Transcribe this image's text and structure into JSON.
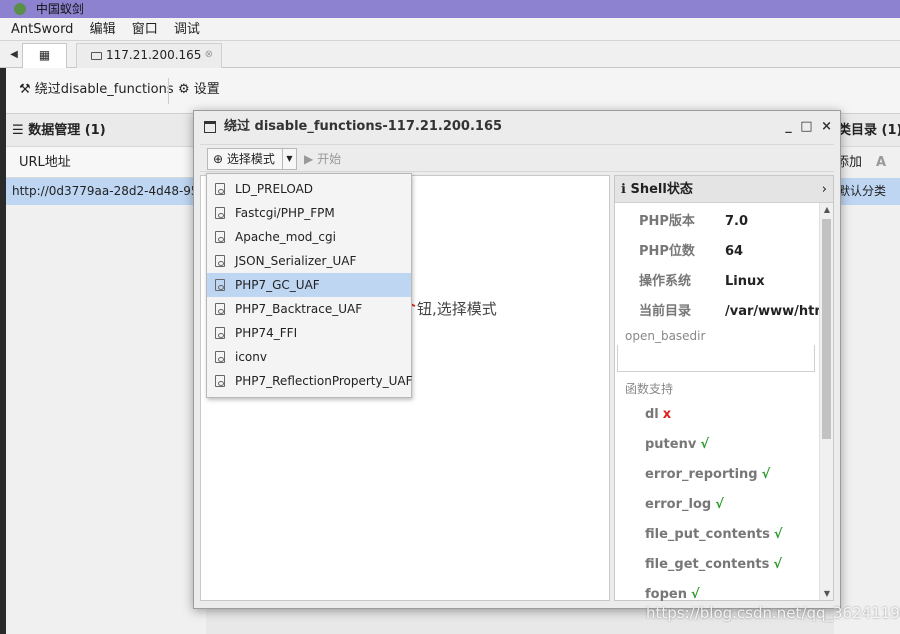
{
  "titlebar": {
    "title": "中国蚁剑"
  },
  "menu": [
    "AntSword",
    "编辑",
    "窗口",
    "调试"
  ],
  "tabs": {
    "home_icon": "grid-icon",
    "host": "117.21.200.165"
  },
  "toolbar": {
    "bypass": "绕过disable_functions",
    "settings": "设置"
  },
  "left_panel": {
    "title": "数据管理 (1)",
    "column": "URL地址",
    "row_url": "http://0d3779aa-28d2-4d48-95"
  },
  "right_panel": {
    "title": "类目录 (1)",
    "add": "添加",
    "rename": "A",
    "row": "默认分类"
  },
  "dialog": {
    "title": "绕过 disable_functions-117.21.200.165",
    "controls": [
      "_",
      "□",
      "×"
    ],
    "mode_button": "选择模式",
    "start_button": "开始",
    "hint": "钮,选择模式",
    "modes": [
      "LD_PRELOAD",
      "Fastcgi/PHP_FPM",
      "Apache_mod_cgi",
      "JSON_Serializer_UAF",
      "PHP7_GC_UAF",
      "PHP7_Backtrace_UAF",
      "PHP74_FFI",
      "iconv",
      "PHP7_ReflectionProperty_UAF"
    ],
    "selected_mode": "PHP7_GC_UAF"
  },
  "shell": {
    "title": "Shell状态",
    "info": [
      {
        "k": "PHP版本",
        "v": "7.0"
      },
      {
        "k": "PHP位数",
        "v": "64"
      },
      {
        "k": "操作系统",
        "v": "Linux"
      },
      {
        "k": "当前目录",
        "v": "/var/www/htm"
      }
    ],
    "open_basedir": "open_basedir",
    "func_support": "函数支持",
    "functions": [
      {
        "name": "dl",
        "mark": "x",
        "ok": false
      },
      {
        "name": "putenv",
        "mark": "√",
        "ok": true
      },
      {
        "name": "error_reporting",
        "mark": "√",
        "ok": true
      },
      {
        "name": "error_log",
        "mark": "√",
        "ok": true
      },
      {
        "name": "file_put_contents",
        "mark": "√",
        "ok": true
      },
      {
        "name": "file_get_contents",
        "mark": "√",
        "ok": true
      },
      {
        "name": "fopen",
        "mark": "√",
        "ok": true
      }
    ]
  },
  "watermark": "https://blog.csdn.net/qq_36241198"
}
